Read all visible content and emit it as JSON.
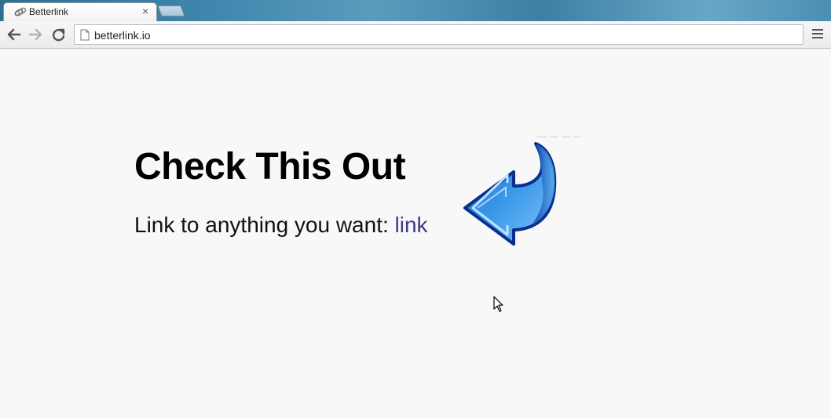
{
  "browser": {
    "tab": {
      "title": "Betterlink",
      "close_label": "×"
    },
    "address": {
      "url": "betterlink.io"
    }
  },
  "page": {
    "heading": "Check This Out",
    "subline_text": "Link to anything you want: ",
    "link_text": "link"
  },
  "icons": {
    "favicon": "link-chain-icon",
    "back": "back-arrow-icon",
    "forward": "forward-arrow-icon",
    "reload": "reload-icon",
    "page": "page-icon",
    "menu": "hamburger-menu-icon",
    "arrow": "curved-blue-arrow-icon",
    "cursor": "mouse-pointer-icon"
  },
  "colors": {
    "link": "#3c3c8a",
    "arrow_blue": "#1e7fd6"
  }
}
